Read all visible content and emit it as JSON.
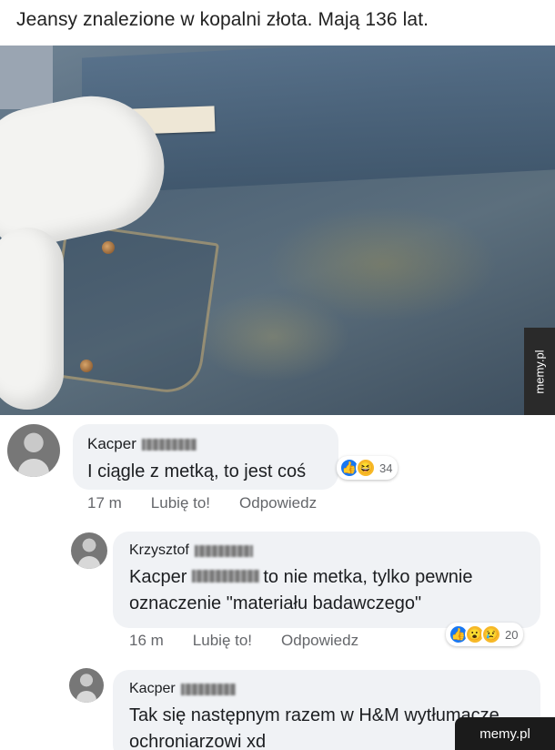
{
  "post": {
    "title": "Jeansy znalezione w kopalni złota. Mają 136 lat.",
    "watermark": "memy.pl"
  },
  "comments": [
    {
      "author_first": "Kacper",
      "text": "I ciągle z metką, to jest coś",
      "reactions": [
        "like-icon",
        "haha-icon"
      ],
      "reaction_count": "34",
      "time": "17 m",
      "like_label": "Lubię to!",
      "reply_label": "Odpowiedz"
    },
    {
      "author_first": "Krzysztof",
      "mention_first": "Kacper",
      "text": "to nie metka, tylko pewnie oznaczenie \"materiału badawczego\"",
      "reactions": [
        "like-icon",
        "wow-icon",
        "sad-icon"
      ],
      "reaction_count": "20",
      "time": "16 m",
      "like_label": "Lubię to!",
      "reply_label": "Odpowiedz"
    },
    {
      "author_first": "Kacper",
      "text": "Tak się następnym razem w H&M wytłumacze ochroniarzowi xd"
    }
  ],
  "footer_badge": "memy.pl"
}
